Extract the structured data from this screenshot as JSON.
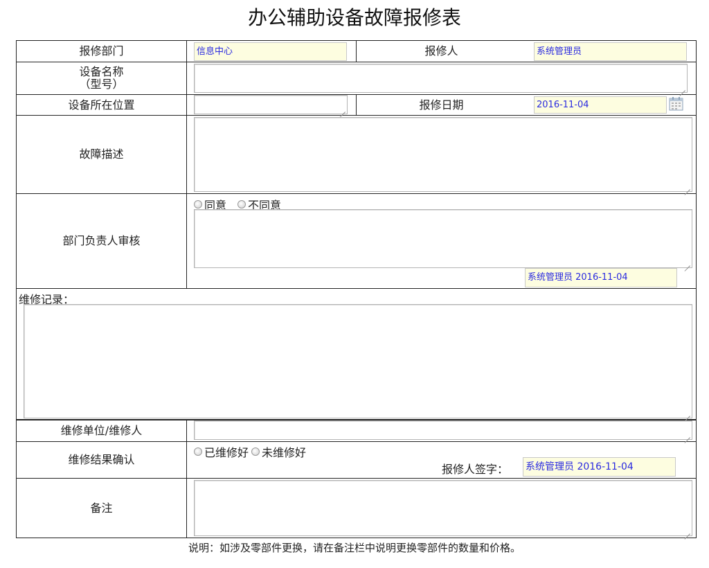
{
  "page_title": "办公辅助设备故障报修表",
  "rows": {
    "dept": {
      "label": "报修部门",
      "value": "信息中心"
    },
    "reporter": {
      "label": "报修人",
      "value": "系统管理员"
    },
    "device_name": {
      "label_line1": "设备名称",
      "label_line2": "（型号）"
    },
    "location": {
      "label": "设备所在位置"
    },
    "report_date": {
      "label": "报修日期",
      "value": "2016-11-04"
    },
    "fault_desc": {
      "label": "故障描述"
    },
    "dept_review": {
      "label": "部门负责人审核",
      "option_agree": "同意",
      "option_disagree": "不同意",
      "signature": "系统管理员 2016-11-04"
    },
    "repair_record": {
      "label": "维修记录："
    },
    "repair_unit": {
      "label": "维修单位/维修人"
    },
    "result": {
      "label": "维修结果确认",
      "option_repaired": "已维修好",
      "option_not_repaired": "未维修好",
      "sign_label": "报修人签字：",
      "signature": "系统管理员 2016-11-04"
    },
    "remark": {
      "label": "备注"
    }
  },
  "footer_note": "说明：如涉及零部件更换，请在备注栏中说明更换零部件的数量和价格。",
  "icons": {
    "calendar": "calendar-icon",
    "resize": "resize-grip-icon"
  },
  "colors": {
    "readonly_bg": "#fdfde0",
    "readonly_text": "#2a2ae0",
    "border": "#222222"
  }
}
